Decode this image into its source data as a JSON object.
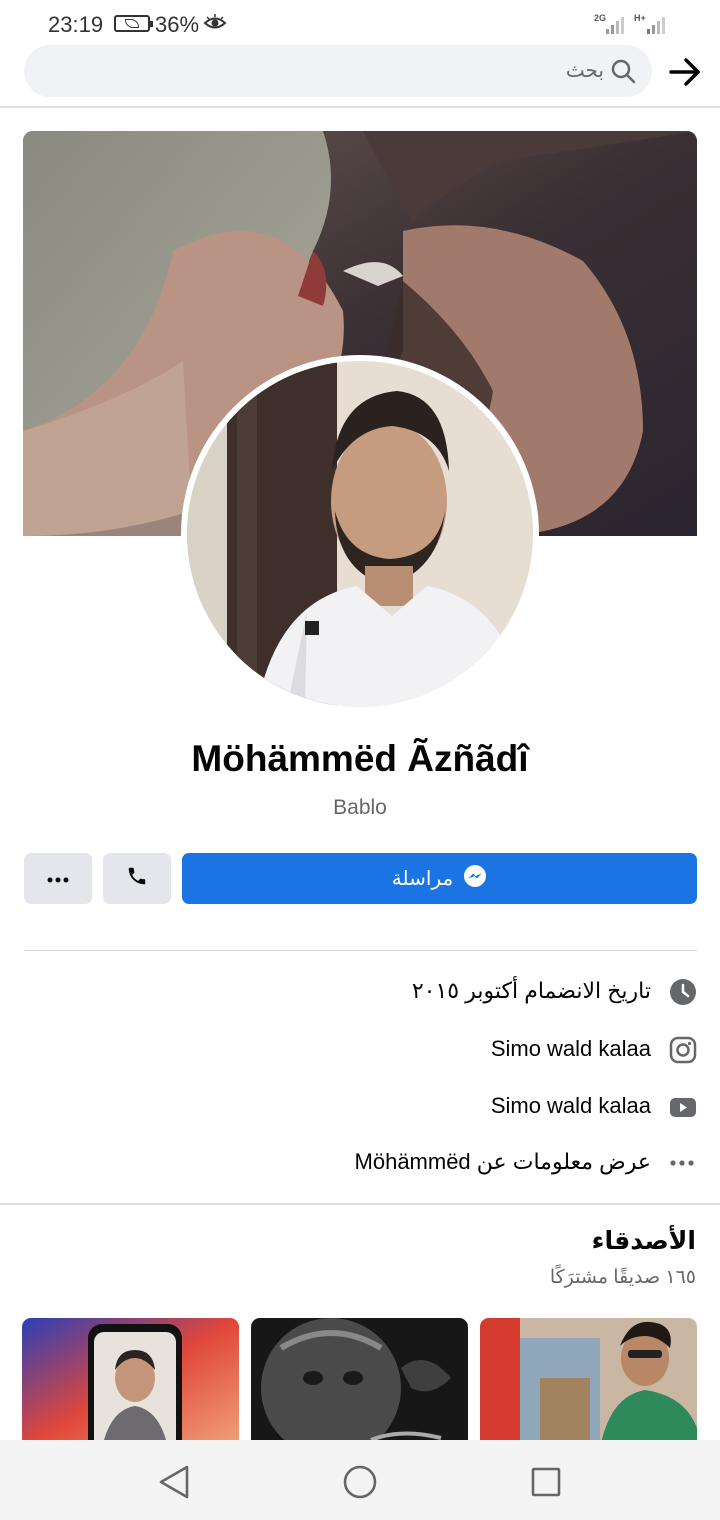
{
  "status_bar": {
    "time": "23:19",
    "battery_percent": "36%",
    "network_1": "2G",
    "network_2": "H+"
  },
  "header": {
    "search_placeholder": "بحث",
    "back_icon": "arrow-right-icon",
    "search_icon": "search-icon"
  },
  "profile": {
    "name": "Möhämmëd Ãzñãdî",
    "nickname": "Bablo"
  },
  "actions": {
    "message_label": "مراسلة",
    "message_icon": "messenger-icon",
    "call_icon": "phone-icon",
    "more_icon": "more-horizontal-icon"
  },
  "info": [
    {
      "icon": "clock-icon",
      "text": "تاريخ الانضمام أكتوبر ٢٠١٥"
    },
    {
      "icon": "instagram-icon",
      "text": "Simo wald kalaa"
    },
    {
      "icon": "youtube-icon",
      "text": "Simo wald kalaa"
    },
    {
      "icon": "more-horizontal-icon",
      "text": "عرض معلومات عن Möhämmëd"
    }
  ],
  "friends": {
    "title": "الأصدقاء",
    "subtitle": "١٦٥ صديقًا مشترَكًا"
  },
  "colors": {
    "accent": "#1b74e4",
    "button_gray": "#e4e6eb",
    "secondary_text": "#65676b",
    "search_bg": "#f0f2f5"
  }
}
